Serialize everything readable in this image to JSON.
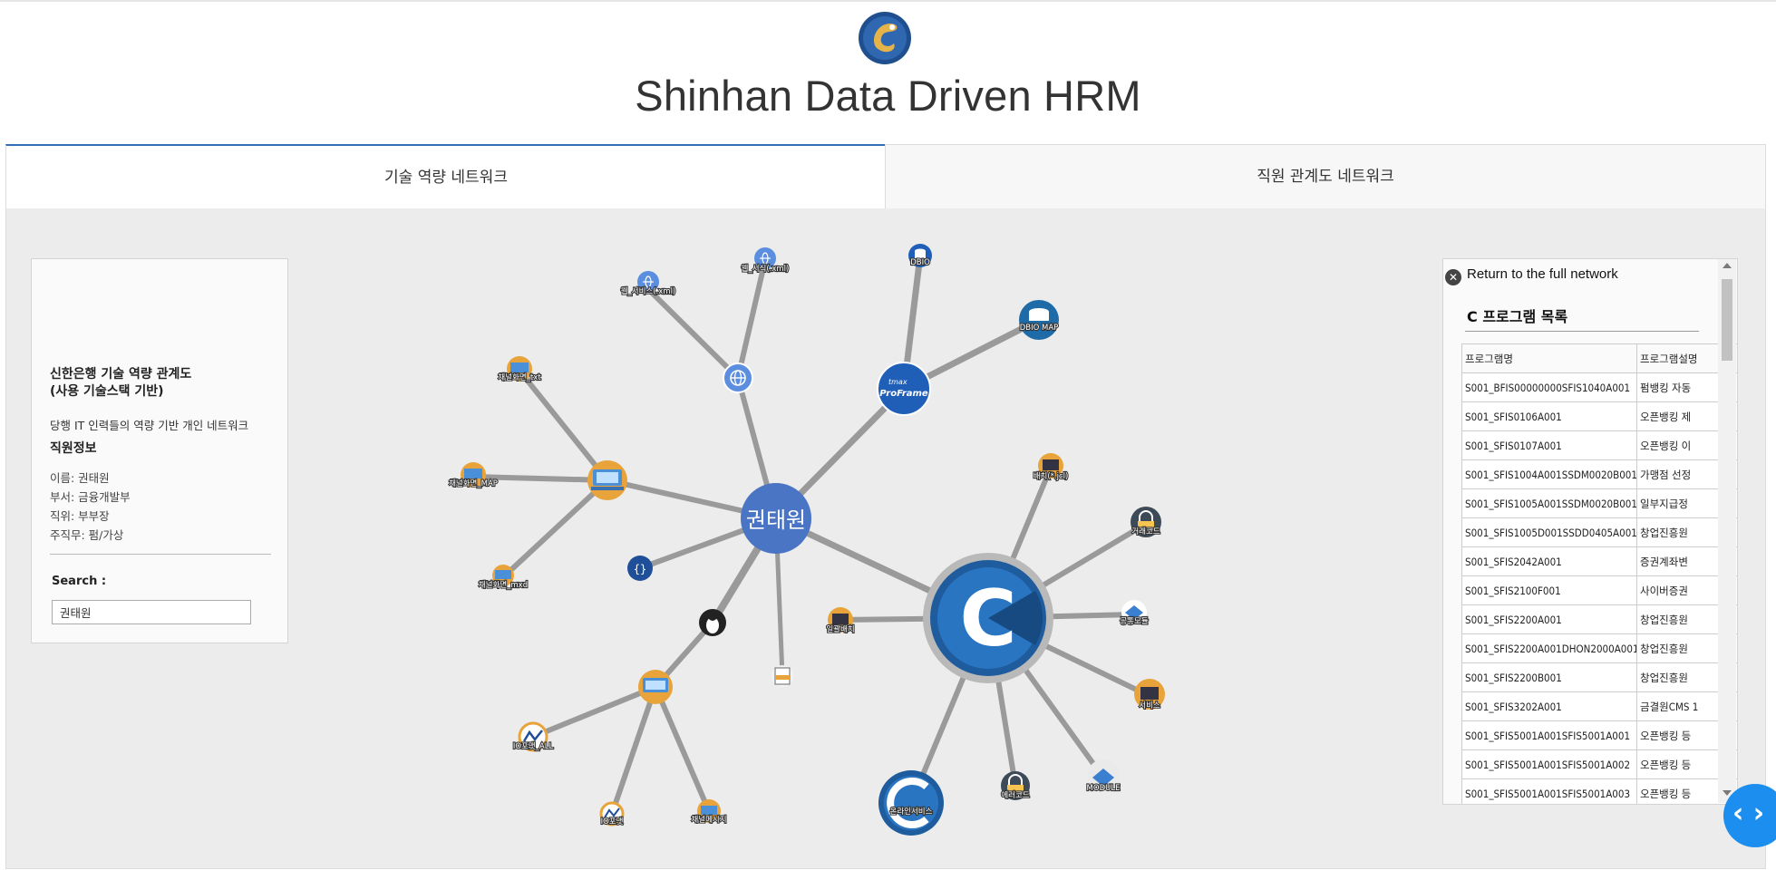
{
  "header": {
    "title": "Shinhan Data Driven HRM"
  },
  "tabs": [
    {
      "label": "기술 역량 네트워크",
      "active": true
    },
    {
      "label": "직원 관계도 네트워크",
      "active": false
    }
  ],
  "info_panel": {
    "title_line1": "신한은행 기술 역량 관계도",
    "title_line2": "(사용 기술스택 기반)",
    "description": "당행 IT 인력들의 역량 기반 개인 네트워크",
    "section_title": "직원정보",
    "fields": [
      "이름: 권태원",
      "부서: 금융개발부",
      "직위: 부부장",
      "주직무: 펌/가상"
    ],
    "search_label": "Search :",
    "search_value": "권태원"
  },
  "network": {
    "center_label": "권태원",
    "proframe_brand": "tmax",
    "proframe_label": "ProFrame",
    "c_node_letter": "C",
    "labels": {
      "web_service": "웹_서비스(.xml)",
      "web_form": "웹_서식(.xml)",
      "dbio": "DBIO",
      "dbio_map": "DBIO MAP",
      "channel_txt": "채널화면_txt",
      "channel_map": "채널화면_MAP",
      "channel_mxd": "채널화면_mxd",
      "batch_jcl": "배치(*.jcl)",
      "trade_code": "거래코드",
      "common_module": "공통모듈",
      "batch_close": "일괄배치",
      "service": "서비스",
      "module": "MODULE",
      "error_code": "에러코드",
      "online_service": "온라인서비스",
      "io_all": "IO포맷_ALL",
      "io_format": "IO포맷",
      "channel_msg": "채널메시지"
    },
    "colors": {
      "edge": "#9a9a9a",
      "center": "#4a74c4",
      "c_node": "#1e5c9d",
      "accent": "#e8a43a"
    }
  },
  "program_panel": {
    "return_label": "Return to the full network",
    "title": "C 프로그램 목록",
    "columns": [
      "프로그램명",
      "프로그램설명"
    ],
    "rows": [
      [
        "S001_BFIS00000000SFIS1040A001",
        "펌뱅킹 자동"
      ],
      [
        "S001_SFIS0106A001",
        "오픈뱅킹 제"
      ],
      [
        "S001_SFIS0107A001",
        "오픈뱅킹 이"
      ],
      [
        "S001_SFIS1004A001SSDM0020B001",
        "가맹점 선정"
      ],
      [
        "S001_SFIS1005A001SSDM0020B001",
        "일부지급정"
      ],
      [
        "S001_SFIS1005D001SSDD0405A001",
        "창업진흥원"
      ],
      [
        "S001_SFIS2042A001",
        "증권계좌변"
      ],
      [
        "S001_SFIS2100F001",
        "사이버증권"
      ],
      [
        "S001_SFIS2200A001",
        "창업진흥원"
      ],
      [
        "S001_SFIS2200A001DHON2000A001",
        "창업진흥원"
      ],
      [
        "S001_SFIS2200B001",
        "창업진흥원"
      ],
      [
        "S001_SFIS3202A001",
        "금결원CMS 1"
      ],
      [
        "S001_SFIS5001A001SFIS5001A001",
        "오픈뱅킹 등"
      ],
      [
        "S001_SFIS5001A001SFIS5001A002",
        "오픈뱅킹 등"
      ],
      [
        "S001_SFIS5001A001SFIS5001A003",
        "오픈뱅킹 등"
      ]
    ]
  },
  "fab": {
    "label": "‹ ›"
  }
}
